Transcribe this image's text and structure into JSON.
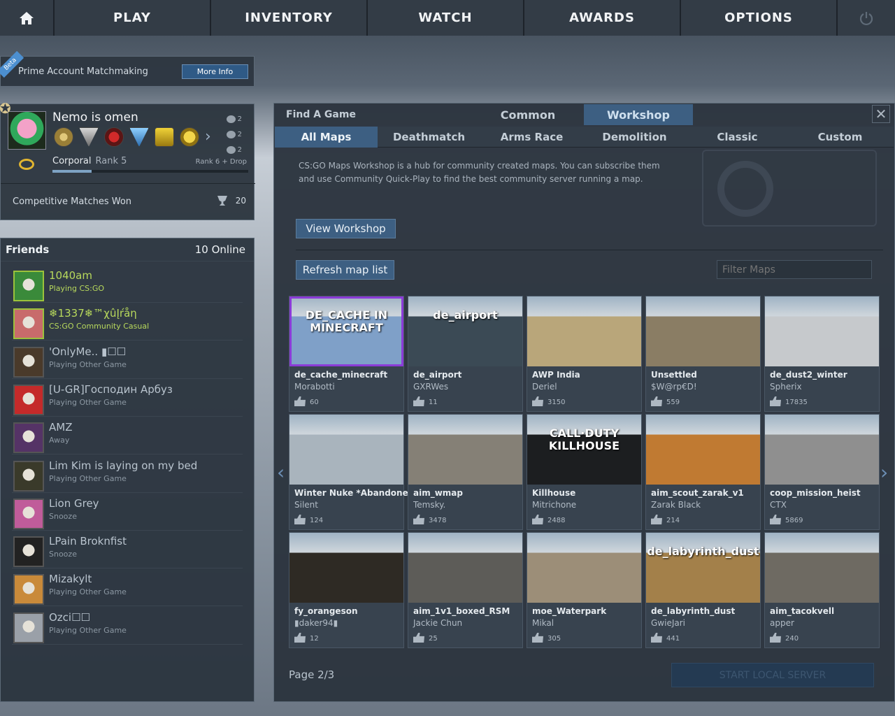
{
  "nav": {
    "home_icon": "home-icon",
    "items": [
      "PLAY",
      "INVENTORY",
      "WATCH",
      "AWARDS",
      "OPTIONS"
    ],
    "power_icon": "power-icon"
  },
  "prime": {
    "beta": "Beta",
    "label": "Prime Account Matchmaking",
    "button": "More Info"
  },
  "profile": {
    "name": "Nemo is omen",
    "stats": [
      "2",
      "2",
      "2"
    ],
    "rank_title": "Corporal",
    "rank": "Rank 5",
    "next_rank": "Rank 6 + Drop",
    "xp_progress": 0.2,
    "matches_label": "Competitive Matches Won",
    "matches_won": "20"
  },
  "friends": {
    "title": "Friends",
    "online": "10 Online",
    "list": [
      {
        "name": "1040am",
        "status": "Playing CS:GO",
        "playing": true,
        "color": "#3a8a3a"
      },
      {
        "name": "❄1337❄™χûĮŕåη",
        "status": "CS:GO Community Casual",
        "playing": true,
        "color": "#c86b6b"
      },
      {
        "name": "'OnlyMe.. ▮☐☐",
        "status": "Playing Other Game",
        "playing": false,
        "color": "#4a3a2a"
      },
      {
        "name": "[U-GR]Господин Арбуз",
        "status": "Playing Other Game",
        "playing": false,
        "color": "#c42a2a"
      },
      {
        "name": "AMZ",
        "status": "Away",
        "playing": false,
        "color": "#553366"
      },
      {
        "name": "Lim Kim is laying on my bed",
        "status": "Playing Other Game",
        "playing": false,
        "color": "#3a3a2a"
      },
      {
        "name": "Lion Grey",
        "status": "Snooze",
        "playing": false,
        "color": "#c05c9a"
      },
      {
        "name": "LPain Broknfist",
        "status": "Snooze",
        "playing": false,
        "color": "#222222"
      },
      {
        "name": "Mizakylt",
        "status": "Playing Other Game",
        "playing": false,
        "color": "#c98a3a"
      },
      {
        "name": "Ozci☐☐",
        "status": "Playing Other Game",
        "playing": false,
        "color": "#9aa0a8"
      }
    ]
  },
  "main": {
    "title": "Find A Game",
    "mode_tabs": [
      "Common",
      "Workshop"
    ],
    "active_mode": "Workshop",
    "close_icon": "close-icon",
    "sub_tabs": [
      "All Maps",
      "Deathmatch",
      "Arms Race",
      "Demolition",
      "Classic",
      "Custom"
    ],
    "active_sub_tab": "All Maps",
    "description": "CS:GO Maps Workshop is a hub for community created maps.  You can subscribe them and use Community Quick-Play to find the best community server running a map.",
    "view_workshop": "View Workshop",
    "refresh": "Refresh map list",
    "filter_placeholder": "Filter Maps",
    "page": "Page 2/3",
    "start_server": "START LOCAL SERVER",
    "maps": [
      {
        "name": "de_cache_minecraft",
        "author": "Morabotti",
        "likes": "60",
        "thumb_text": "DE_CACHE IN MINECRAFT",
        "color": "#7fa0c8",
        "selected": true
      },
      {
        "name": "de_airport",
        "author": "GXRWes",
        "likes": "11",
        "thumb_text": "de_airport",
        "color": "#3b4a55",
        "selected": false
      },
      {
        "name": "AWP India",
        "author": "Deriel",
        "likes": "3150",
        "thumb_text": "",
        "color": "#b9a67a",
        "selected": false
      },
      {
        "name": "Unsettled",
        "author": "$W@rp€D!",
        "likes": "559",
        "thumb_text": "",
        "color": "#8a7d64",
        "selected": false
      },
      {
        "name": "de_dust2_winter",
        "author": "Spherix",
        "likes": "17835",
        "thumb_text": "",
        "color": "#c6c9cc",
        "selected": false
      },
      {
        "name": "Winter Nuke *Abandoned*",
        "author": "Silent",
        "likes": "124",
        "thumb_text": "",
        "color": "#a9b4bd",
        "selected": false
      },
      {
        "name": "aim_wmap",
        "author": "Temsky.",
        "likes": "3478",
        "thumb_text": "",
        "color": "#858076",
        "selected": false
      },
      {
        "name": "Killhouse",
        "author": "Mitrichone",
        "likes": "2488",
        "thumb_text": "CALL·DUTY KILLHOUSE",
        "color": "#1c1e20",
        "selected": false
      },
      {
        "name": "aim_scout_zarak_v1",
        "author": "Zarak Black",
        "likes": "214",
        "thumb_text": "",
        "color": "#c07a32",
        "selected": false
      },
      {
        "name": "coop_mission_heist",
        "author": "CTX",
        "likes": "5869",
        "thumb_text": "",
        "color": "#8f8f8f",
        "selected": false
      },
      {
        "name": "fy_orangeson",
        "author": "▮daker94▮",
        "likes": "12",
        "thumb_text": "",
        "color": "#2e2a24",
        "selected": false
      },
      {
        "name": "aim_1v1_boxed_RSM",
        "author": "Jackie Chun",
        "likes": "25",
        "thumb_text": "",
        "color": "#5d5c58",
        "selected": false
      },
      {
        "name": "moe_Waterpark",
        "author": "Mikal",
        "likes": "305",
        "thumb_text": "",
        "color": "#9c8e78",
        "selected": false
      },
      {
        "name": "de_labyrinth_dust",
        "author": "GwieJari",
        "likes": "441",
        "thumb_text": "de_labyrinth_dust",
        "color": "#a3804a",
        "selected": false
      },
      {
        "name": "aim_tacokvell",
        "author": "apper",
        "likes": "240",
        "thumb_text": "",
        "color": "#6e6a62",
        "selected": false
      }
    ]
  }
}
